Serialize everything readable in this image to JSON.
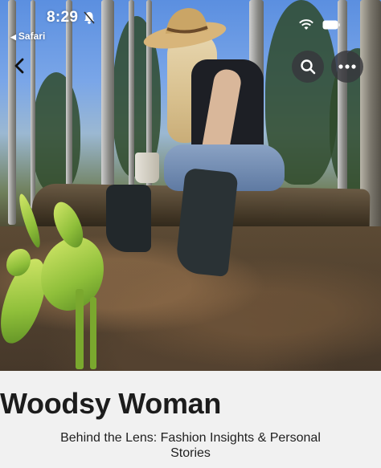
{
  "status_bar": {
    "time": "8:29",
    "back_app": "Safari",
    "bell_icon": "bell-slash-icon",
    "wifi_icon": "wifi-icon",
    "battery_icon": "battery-icon"
  },
  "nav": {
    "back_icon": "chevron-left-icon",
    "search_icon": "search-icon",
    "more_icon": "ellipsis-icon"
  },
  "hero": {
    "image_subject": "woman-in-woods-photo"
  },
  "card": {
    "title": "Woodsy Woman",
    "subtitle": "Behind the Lens: Fashion Insights & Personal Stories"
  },
  "colors": {
    "title_text": "#1c1c1c",
    "card_background": "#f1f1f1",
    "button_background": "#37373c"
  }
}
